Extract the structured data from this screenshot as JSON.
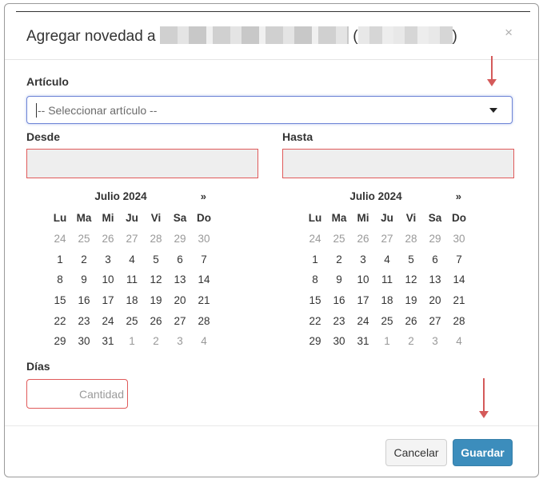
{
  "modal": {
    "title_prefix": "Agregar novedad a",
    "paren_open": "(",
    "paren_close": ")",
    "close_glyph": "×"
  },
  "form": {
    "articulo_label": "Artículo",
    "articulo_placeholder": "-- Seleccionar artículo --",
    "desde_label": "Desde",
    "hasta_label": "Hasta",
    "dias_label": "Días",
    "cantidad_placeholder": "Cantidad"
  },
  "calendars": [
    {
      "month": "Julio 2024",
      "next": "»",
      "weekdays": [
        "Lu",
        "Ma",
        "Mi",
        "Ju",
        "Vi",
        "Sa",
        "Do"
      ],
      "days": [
        [
          "24",
          "25",
          "26",
          "27",
          "28",
          "29",
          "30"
        ],
        [
          "1",
          "2",
          "3",
          "4",
          "5",
          "6",
          "7"
        ],
        [
          "8",
          "9",
          "10",
          "11",
          "12",
          "13",
          "14"
        ],
        [
          "15",
          "16",
          "17",
          "18",
          "19",
          "20",
          "21"
        ],
        [
          "22",
          "23",
          "24",
          "25",
          "26",
          "27",
          "28"
        ],
        [
          "29",
          "30",
          "31",
          "1",
          "2",
          "3",
          "4"
        ]
      ]
    },
    {
      "month": "Julio 2024",
      "next": "»",
      "weekdays": [
        "Lu",
        "Ma",
        "Mi",
        "Ju",
        "Vi",
        "Sa",
        "Do"
      ],
      "days": [
        [
          "24",
          "25",
          "26",
          "27",
          "28",
          "29",
          "30"
        ],
        [
          "1",
          "2",
          "3",
          "4",
          "5",
          "6",
          "7"
        ],
        [
          "8",
          "9",
          "10",
          "11",
          "12",
          "13",
          "14"
        ],
        [
          "15",
          "16",
          "17",
          "18",
          "19",
          "20",
          "21"
        ],
        [
          "22",
          "23",
          "24",
          "25",
          "26",
          "27",
          "28"
        ],
        [
          "29",
          "30",
          "31",
          "1",
          "2",
          "3",
          "4"
        ]
      ]
    }
  ],
  "footer": {
    "cancel_label": "Cancelar",
    "save_label": "Guardar"
  },
  "colors": {
    "primary": "#3c8dbc",
    "error_border": "#e05a5a",
    "annotation_arrow": "#d45a5a",
    "focus_border": "#6f86d6"
  }
}
